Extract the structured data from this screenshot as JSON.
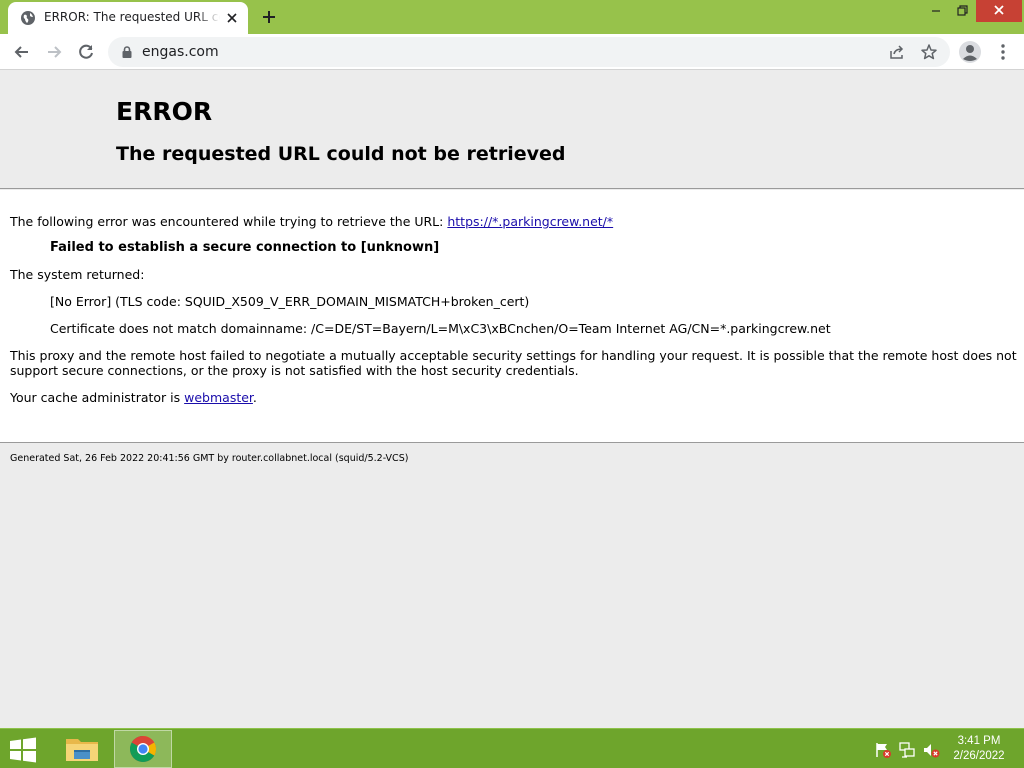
{
  "browser": {
    "tab": {
      "title": "ERROR: The requested URL could not be retrieved"
    },
    "address": {
      "url": "engas.com"
    }
  },
  "page": {
    "heading": "ERROR",
    "subheading": "The requested URL could not be retrieved",
    "intro_text": "The following error was encountered while trying to retrieve the URL:",
    "intro_link": "https://*.parkingcrew.net/*",
    "failure": "Failed to establish a secure connection to [unknown]",
    "system_returned": "The system returned:",
    "tls_error": "[No Error] (TLS code: SQUID_X509_V_ERR_DOMAIN_MISMATCH+broken_cert)",
    "cert_error": "Certificate does not match domainname: /C=DE/ST=Bayern/L=M\\xC3\\xBCnchen/O=Team Internet AG/CN=*.parkingcrew.net",
    "explanation_line1": "This proxy and the remote host failed to negotiate a mutually acceptable security settings for handling your request. It is possible that the remote host does not",
    "explanation_line2": "support secure connections, or the proxy is not satisfied with the host security credentials.",
    "admin_prefix": "Your cache administrator is",
    "admin_link": "webmaster",
    "admin_suffix": ".",
    "footer": "Generated Sat, 26 Feb 2022 20:41:56 GMT by router.collabnet.local (squid/5.2-VCS)"
  },
  "taskbar": {
    "time": "3:41 PM",
    "date": "2/26/2022"
  },
  "colors": {
    "titlebar": "#97c24b",
    "taskbar": "#6ea52c",
    "close_button": "#c74134",
    "link": "#1a0dab"
  },
  "icons": [
    "globe-icon",
    "close-icon",
    "plus-icon",
    "minimize-icon",
    "restore-icon",
    "back-icon",
    "forward-icon",
    "reload-icon",
    "lock-icon",
    "share-icon",
    "star-icon",
    "profile-icon",
    "menu-icon",
    "windows-start-icon",
    "file-explorer-icon",
    "chrome-icon",
    "action-center-flag-icon",
    "network-icon",
    "volume-muted-icon"
  ]
}
